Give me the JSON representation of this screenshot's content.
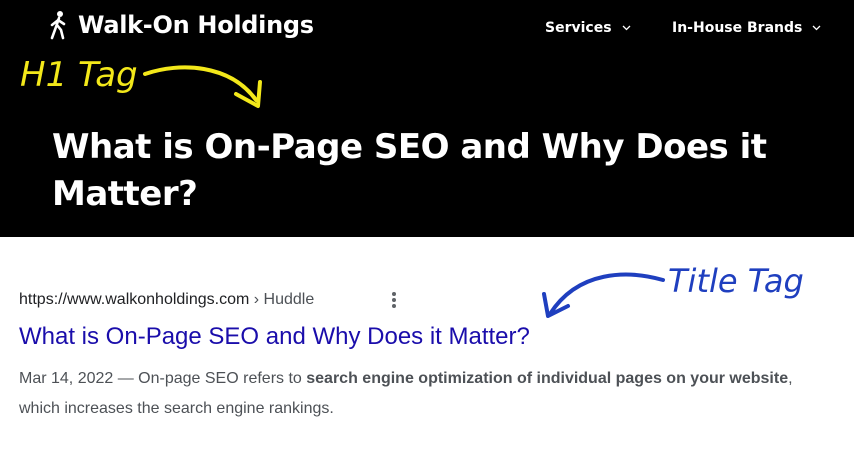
{
  "header": {
    "logo_text": "Walk-On Holdings",
    "nav": [
      {
        "label": "Services"
      },
      {
        "label": "In-House Brands"
      }
    ]
  },
  "annotations": {
    "h1_tag": "H1 Tag",
    "title_tag": "Title Tag",
    "h1_color": "#f3e81a",
    "title_color": "#1f3fbf"
  },
  "hero": {
    "heading": "What is On-Page SEO and Why Does it Matter?"
  },
  "serp": {
    "url": "https://www.walkonholdings.com",
    "separator": " › ",
    "crumb": "Huddle",
    "title": "What is On-Page SEO and Why Does it Matter?",
    "snippet": {
      "date": "Mar 14, 2022",
      "dash": " — ",
      "text1": "On-page SEO refers to ",
      "bold1": "search engine optimization of individual pages on your website",
      "text2": ", which increases the search engine rankings."
    },
    "link_color": "#1a0dab"
  }
}
